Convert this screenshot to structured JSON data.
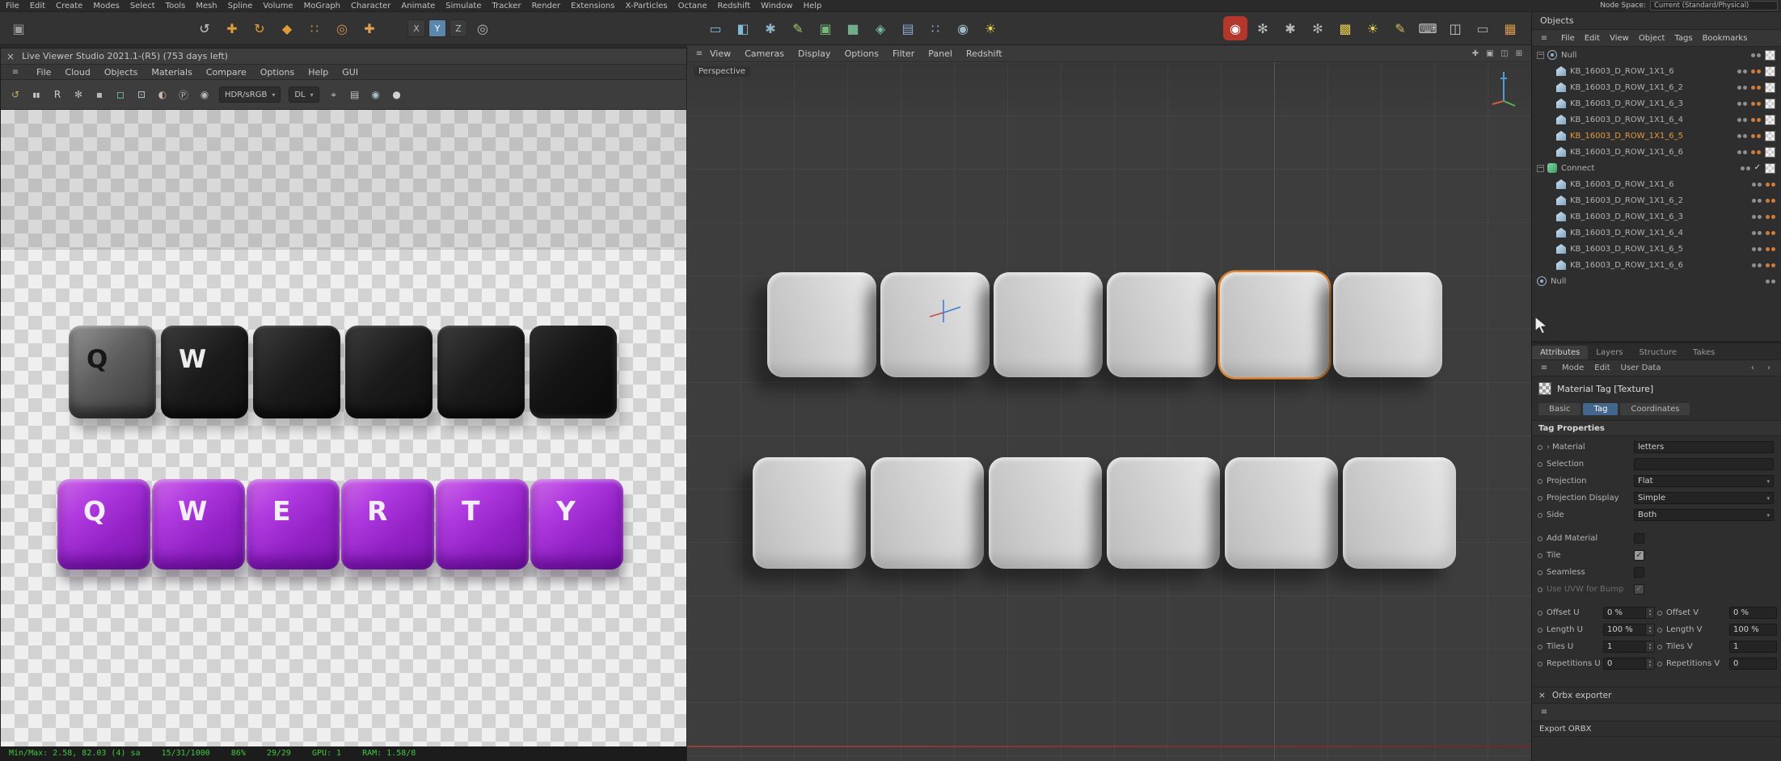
{
  "menubar": {
    "items": [
      "File",
      "Edit",
      "Create",
      "Modes",
      "Select",
      "Tools",
      "Mesh",
      "Spline",
      "Volume",
      "MoGraph",
      "Character",
      "Animate",
      "Simulate",
      "Tracker",
      "Render",
      "Extensions",
      "X-Particles",
      "Octane",
      "Redshift",
      "Window",
      "Help"
    ],
    "node_space_label": "Node Space:",
    "node_space_value": "Current (Standard/Physical)"
  },
  "toolbar": {
    "app_icons": [
      "app-icon"
    ],
    "left_icons": [
      "undo-icon",
      "move-tool-icon",
      "rotate-tool-icon",
      "scale-tool-icon",
      "points-mode-icon",
      "snap-icon",
      "add-object-icon"
    ],
    "axis_buttons": [
      {
        "label": "X",
        "active": false
      },
      {
        "label": "Y",
        "active": true
      },
      {
        "label": "Z",
        "active": false
      }
    ],
    "axis_extra_icons": [
      "coordinate-system-icon"
    ],
    "mid_icons": [
      "render-view-icon",
      "render-region-icon",
      "render-settings-icon",
      "spline-pen-icon",
      "cube-primitive-icon",
      "generators-icon",
      "deformers-icon",
      "fields-icon",
      "mograph-icon",
      "simulate-icon",
      "light-icon"
    ],
    "right_icons": [
      "octane-logo-icon",
      "materials-icon",
      "wrench-icon",
      "settings-gear-icon",
      "texture-icon",
      "sun-icon",
      "brush-icon",
      "keyboard-icon",
      "display-a-icon",
      "display-b-icon",
      "layout-grid-icon"
    ]
  },
  "live_viewer": {
    "title": "Live Viewer Studio 2021.1-(R5) (753 days left)",
    "menu": [
      "File",
      "Cloud",
      "Objects",
      "Materials",
      "Compare",
      "Options",
      "Help",
      "GUI"
    ],
    "toolbar": {
      "icons_left": [
        "refresh-icon",
        "pause-icon",
        "restart-icon",
        "gear-icon",
        "lock-icon",
        "region-icon",
        "picker-icon",
        "clay-icon",
        "pick-material-icon",
        "camera-icon"
      ],
      "dropdown1": "HDR/sRGB",
      "dropdown2": "DL",
      "icons_right": [
        "focus-icon",
        "film-icon",
        "camera2-icon",
        "sphere-icon"
      ]
    },
    "keys_top": [
      {
        "letter": "Q",
        "variant": "lit"
      },
      {
        "letter": "W",
        "variant": "dark"
      },
      {
        "letter": "",
        "variant": "dark"
      },
      {
        "letter": "",
        "variant": "dark"
      },
      {
        "letter": "",
        "variant": "dark"
      },
      {
        "letter": "",
        "variant": "darkest"
      }
    ],
    "keys_bottom": [
      {
        "letter": "Q"
      },
      {
        "letter": "W"
      },
      {
        "letter": "E"
      },
      {
        "letter": "R"
      },
      {
        "letter": "T"
      },
      {
        "letter": "Y"
      }
    ],
    "status_segments": [
      "Min/Max: 2.58, 82.03 (4) sa",
      "15/31/1000",
      "86%",
      "29/29",
      "GPU: 1",
      "RAM: 1.58/8"
    ]
  },
  "viewport": {
    "menu": [
      "View",
      "Cameras",
      "Display",
      "Options",
      "Filter",
      "Panel",
      "Redshift"
    ],
    "menu_icons": [
      "pin-icon",
      "grid-a-icon",
      "grid-b-icon",
      "expand-icon"
    ],
    "label": "Perspective",
    "top_row_count": 6,
    "selected_top_index": 4,
    "bottom_row_count": 6
  },
  "objects_panel": {
    "title": "Objects",
    "menu": [
      "File",
      "Edit",
      "View",
      "Object",
      "Tags",
      "Bookmarks"
    ],
    "rows": [
      {
        "label": "Null",
        "icon": "null",
        "indent": 0,
        "expand": true,
        "tags": [
          "dots",
          "texture"
        ]
      },
      {
        "label": "KB_16003_D_ROW_1X1_6",
        "icon": "poly",
        "indent": 1,
        "tags": [
          "dots",
          "phong",
          "texture"
        ]
      },
      {
        "label": "KB_16003_D_ROW_1X1_6_2",
        "icon": "poly",
        "indent": 1,
        "tags": [
          "dots",
          "phong",
          "texture"
        ]
      },
      {
        "label": "KB_16003_D_ROW_1X1_6_3",
        "icon": "poly",
        "indent": 1,
        "tags": [
          "dots",
          "phong",
          "texture"
        ]
      },
      {
        "label": "KB_16003_D_ROW_1X1_6_4",
        "icon": "poly",
        "indent": 1,
        "tags": [
          "dots",
          "phong",
          "texture"
        ]
      },
      {
        "label": "KB_16003_D_ROW_1X1_6_5",
        "icon": "poly",
        "indent": 1,
        "selected": true,
        "tags": [
          "dots",
          "phong",
          "texture"
        ]
      },
      {
        "label": "KB_16003_D_ROW_1X1_6_6",
        "icon": "poly",
        "indent": 1,
        "tags": [
          "dots",
          "phong",
          "texture"
        ]
      },
      {
        "label": "Connect",
        "icon": "connect",
        "indent": 0,
        "expand": true,
        "tags": [
          "dots",
          "check",
          "texture"
        ]
      },
      {
        "label": "KB_16003_D_ROW_1X1_6",
        "icon": "poly",
        "indent": 1,
        "tags": [
          "dots",
          "phong"
        ]
      },
      {
        "label": "KB_16003_D_ROW_1X1_6_2",
        "icon": "poly",
        "indent": 1,
        "tags": [
          "dots",
          "phong"
        ]
      },
      {
        "label": "KB_16003_D_ROW_1X1_6_3",
        "icon": "poly",
        "indent": 1,
        "tags": [
          "dots",
          "phong"
        ]
      },
      {
        "label": "KB_16003_D_ROW_1X1_6_4",
        "icon": "poly",
        "indent": 1,
        "tags": [
          "dots",
          "phong"
        ]
      },
      {
        "label": "KB_16003_D_ROW_1X1_6_5",
        "icon": "poly",
        "indent": 1,
        "tags": [
          "dots",
          "phong"
        ]
      },
      {
        "label": "KB_16003_D_ROW_1X1_6_6",
        "icon": "poly",
        "indent": 1,
        "tags": [
          "dots",
          "phong"
        ]
      },
      {
        "label": "Null",
        "icon": "null",
        "indent": 0,
        "tags": [
          "dots"
        ]
      }
    ]
  },
  "attributes_panel": {
    "tabs": [
      "Attributes",
      "Layers",
      "Structure",
      "Takes"
    ],
    "active_tab": "Attributes",
    "mode_row": [
      "Mode",
      "Edit",
      "User Data"
    ],
    "nav_icons": [
      "prev-icon",
      "next-icon"
    ],
    "object_title": "Material Tag [Texture]",
    "sub_tabs": [
      {
        "label": "Basic"
      },
      {
        "label": "Tag",
        "active": true
      },
      {
        "label": "Coordinates"
      }
    ],
    "section_title": "Tag Properties",
    "props_single": [
      {
        "label": "Material",
        "type": "input",
        "value": "letters",
        "arrow": true
      },
      {
        "label": "Selection",
        "type": "input",
        "value": ""
      },
      {
        "label": "Projection",
        "type": "select",
        "value": "Flat"
      },
      {
        "label": "Projection Display",
        "type": "select",
        "value": "Simple"
      },
      {
        "label": "Side",
        "type": "select",
        "value": "Both"
      },
      {
        "label": "Add Material",
        "type": "checkbox",
        "checked": false,
        "gap": true
      },
      {
        "label": "Tile",
        "type": "checkbox",
        "checked": true
      },
      {
        "label": "Seamless",
        "type": "checkbox",
        "checked": false
      },
      {
        "label": "Use UVW for Bump",
        "type": "checkbox",
        "checked": true,
        "disabled": true
      }
    ],
    "props_pairs": [
      {
        "l_label": "Offset U",
        "l_value": "0 %",
        "r_label": "Offset V",
        "r_value": "0 %"
      },
      {
        "l_label": "Length U",
        "l_value": "100 %",
        "r_label": "Length V",
        "r_value": "100 %"
      },
      {
        "l_label": "Tiles U",
        "l_value": "1",
        "r_label": "Tiles V",
        "r_value": "1"
      },
      {
        "l_label": "Repetitions U",
        "l_value": "0",
        "r_label": "Repetitions V",
        "r_value": "0"
      }
    ]
  },
  "orbx": {
    "title": "Orbx exporter",
    "export_label": "Export ORBX"
  },
  "colors": {
    "selection_orange": "#de8630",
    "selected_label_orange": "#e49a3e",
    "tab_blue": "#43678c",
    "key_purple": "#9b27cf",
    "viewport_bg": "#3d3d3d",
    "status_green": "#42c742"
  }
}
